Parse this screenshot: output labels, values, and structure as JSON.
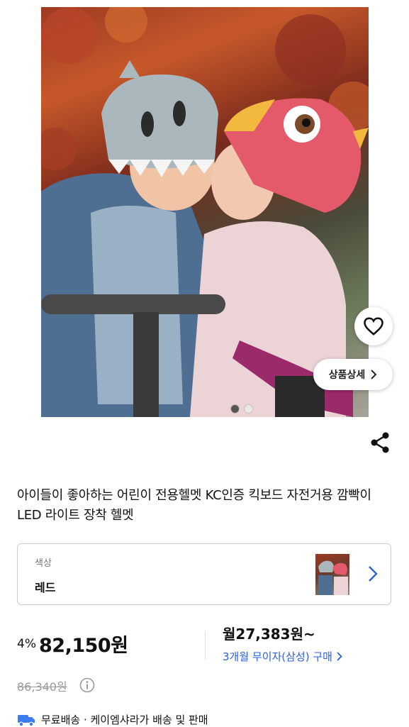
{
  "product": {
    "title": "아이들이 좋아하는 어린이 전용헬멧 KC인증 킥보드 자전거용 깜빡이 LED 라이트 장착 헬멧",
    "carousel": {
      "total": 2,
      "active_index": 0
    },
    "detail_button_label": "상품상세"
  },
  "option": {
    "label": "색상",
    "value": "레드"
  },
  "price": {
    "discount": "4%",
    "sale": "82,150원",
    "original": "86,340원",
    "monthly": "월27,383원~",
    "installment": "3개월 무이자(삼성) 구매"
  },
  "shipping": {
    "text": "무료배송 · 케이엠샤라가 배송 및 판매"
  },
  "colors": {
    "accent_blue": "#2b62d9",
    "text_dark": "#111111",
    "muted": "#9a9a9a"
  }
}
